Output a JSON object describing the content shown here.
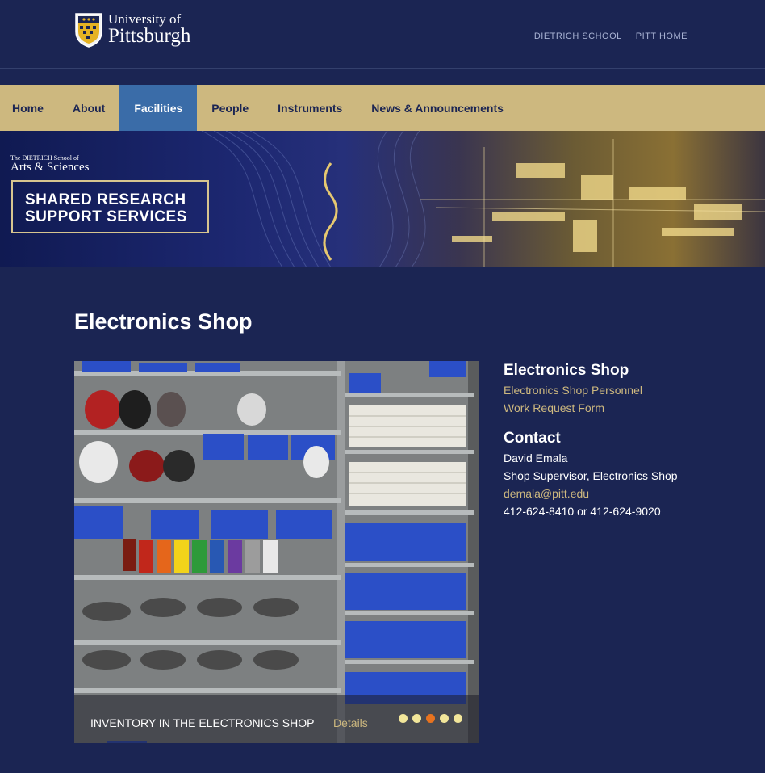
{
  "header": {
    "logo_line1": "University of",
    "logo_line2": "Pittsburgh",
    "links": [
      "DIETRICH SCHOOL",
      "PITT HOME"
    ]
  },
  "nav": {
    "items": [
      "Home",
      "About",
      "Facilities",
      "People",
      "Instruments",
      "News & Announcements"
    ],
    "active": "Facilities"
  },
  "banner": {
    "school_line1": "The DIETRICH School of",
    "school_line2": "Arts & Sciences",
    "title_line1": "SHARED RESEARCH",
    "title_line2": "SUPPORT SERVICES"
  },
  "main": {
    "title": "Electronics Shop",
    "slideshow": {
      "caption": "INVENTORY IN THE ELECTRONICS SHOP",
      "details_label": "Details",
      "slide_count": 5,
      "active_slide": 3
    }
  },
  "sidebar": {
    "shop_heading": "Electronics Shop",
    "shop_links": [
      "Electronics Shop Personnel",
      "Work Request Form"
    ],
    "contact_heading": "Contact",
    "contact_name": "David Emala",
    "contact_role": "Shop Supervisor, Electronics Shop",
    "contact_email": "demala@pitt.edu",
    "contact_phone": "412-624-8410 or 412-624-9020"
  },
  "colors": {
    "page_bg": "#1b2553",
    "nav_bg": "#cdb87f",
    "nav_active": "#3a6ca8",
    "link_gold": "#cdb87f",
    "dot_active": "#e8731f"
  }
}
